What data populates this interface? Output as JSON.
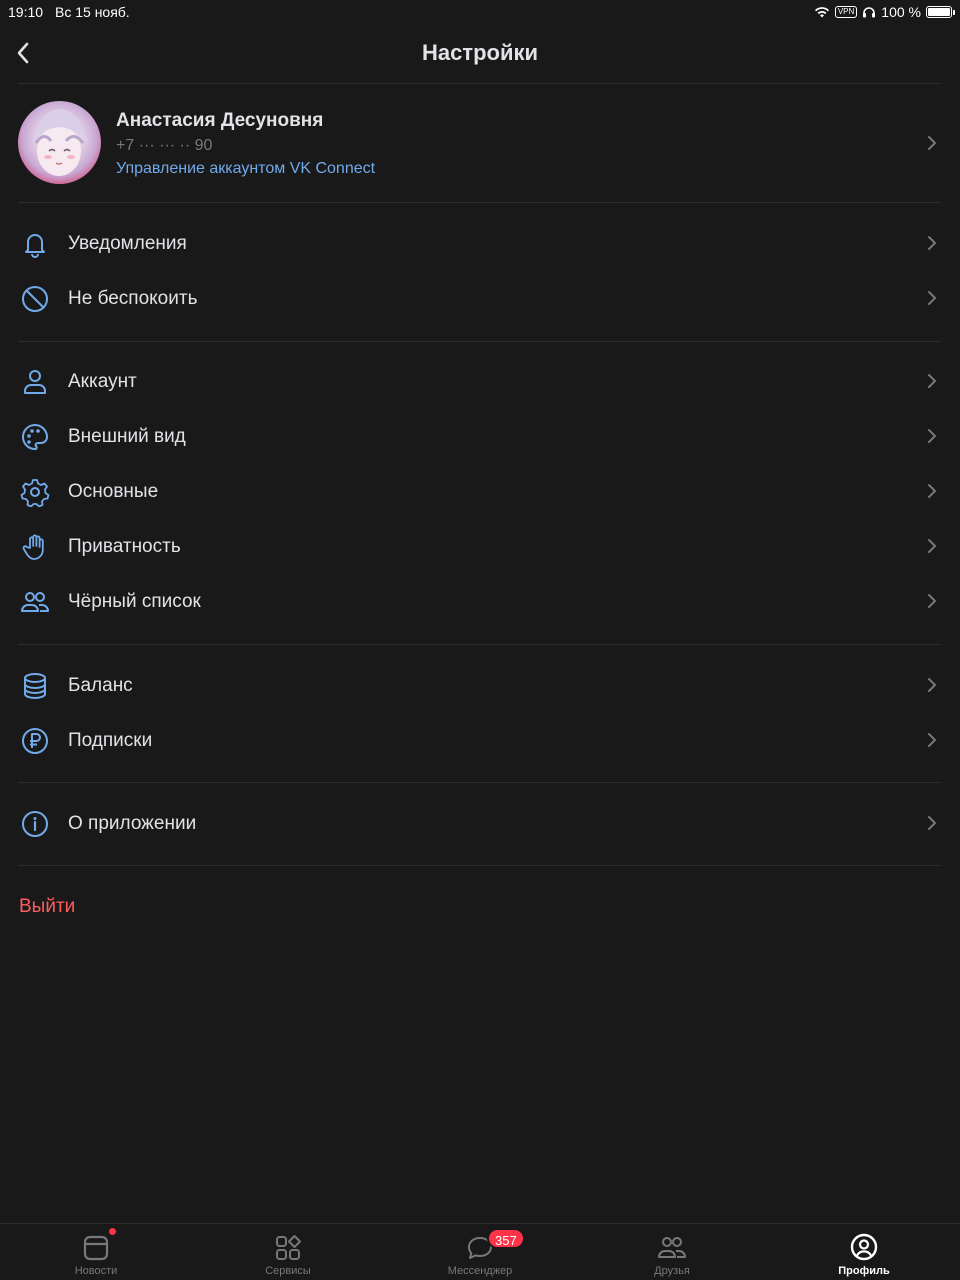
{
  "status_bar": {
    "time": "19:10",
    "date": "Вс 15 нояб.",
    "vpn": "VPN",
    "battery": "100 %"
  },
  "nav": {
    "title": "Настройки"
  },
  "profile": {
    "name": "Анастасия Десуновня",
    "phone": "+7 ··· ··· ·· 90",
    "manage_link": "Управление аккаунтом VK Connect"
  },
  "groups": [
    [
      {
        "label": "Уведомления",
        "icon": "bell-icon"
      },
      {
        "label": "Не беспокоить",
        "icon": "do-not-disturb-icon"
      }
    ],
    [
      {
        "label": "Аккаунт",
        "icon": "user-icon"
      },
      {
        "label": "Внешний вид",
        "icon": "palette-icon"
      },
      {
        "label": "Основные",
        "icon": "gear-icon"
      },
      {
        "label": "Приватность",
        "icon": "hand-icon"
      },
      {
        "label": "Чёрный список",
        "icon": "users-icon"
      }
    ],
    [
      {
        "label": "Баланс",
        "icon": "coins-stack-icon"
      },
      {
        "label": "Подписки",
        "icon": "ruble-icon"
      }
    ],
    [
      {
        "label": "О приложении",
        "icon": "info-icon"
      }
    ]
  ],
  "logout_label": "Выйти",
  "tabs": [
    {
      "label": "Новости",
      "icon": "news-icon",
      "active": false
    },
    {
      "label": "Сервисы",
      "icon": "services-icon",
      "active": false
    },
    {
      "label": "Мессенджер",
      "icon": "message-icon",
      "active": false,
      "badge": "357"
    },
    {
      "label": "Друзья",
      "icon": "friends-icon",
      "active": false
    },
    {
      "label": "Профиль",
      "icon": "profile-icon",
      "active": true
    }
  ],
  "colors": {
    "accent": "#71aaeb",
    "background": "#19191a",
    "danger": "#ff5c5c",
    "badge": "#ff3347"
  }
}
